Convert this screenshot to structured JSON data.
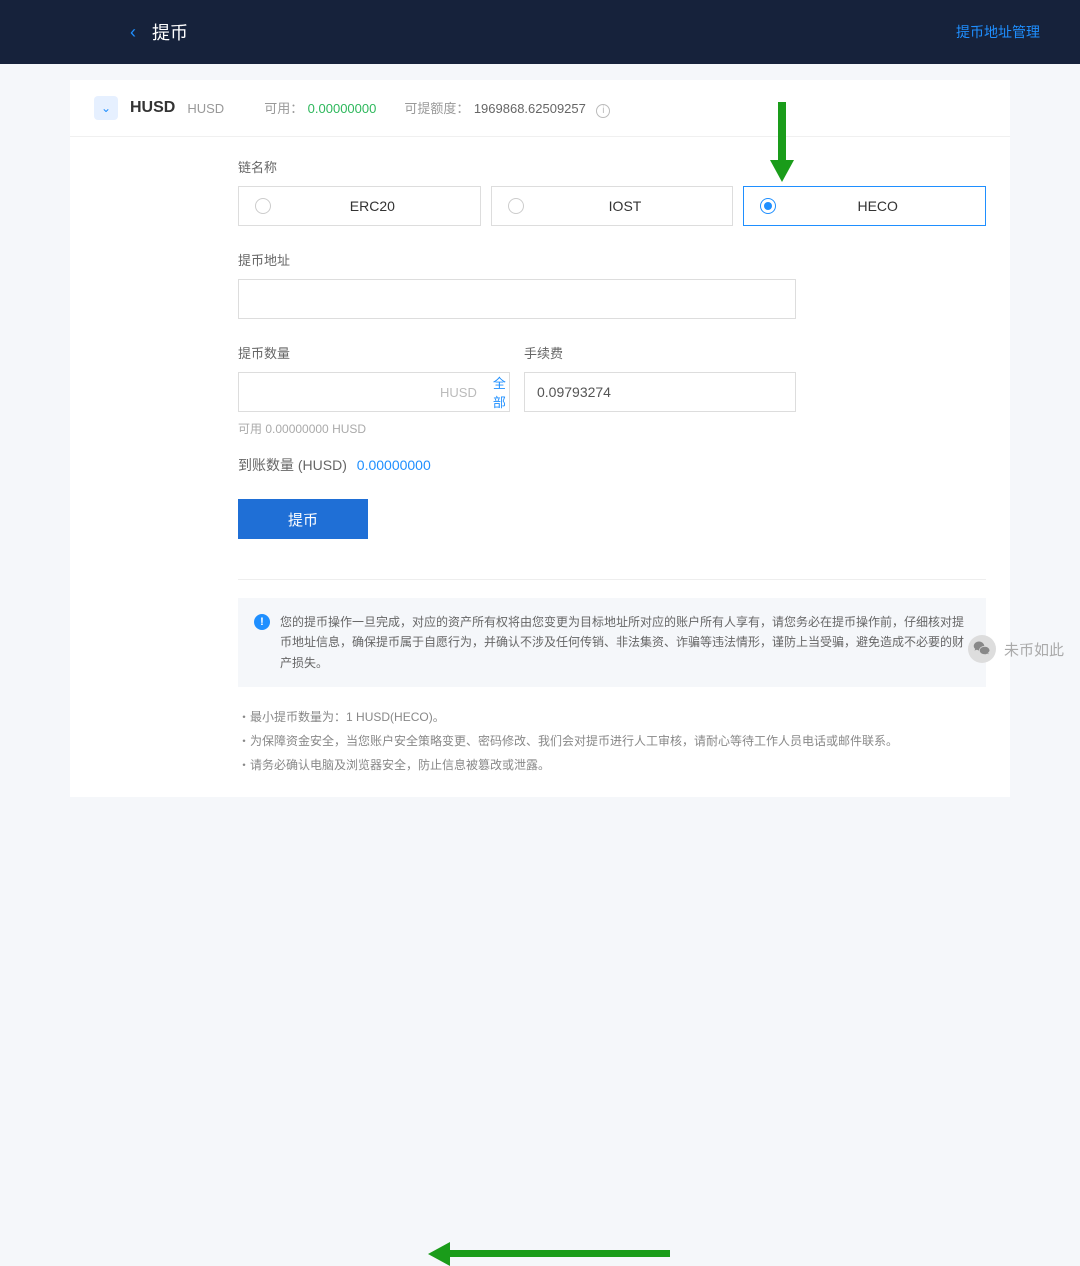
{
  "header": {
    "title": "提币",
    "manage_link": "提币地址管理"
  },
  "coin": {
    "symbol": "HUSD",
    "name": "HUSD",
    "available_label": "可用：",
    "available_value": "0.00000000",
    "limit_label": "可提额度：",
    "limit_value": "1969868.62509257"
  },
  "form": {
    "chain_label": "链名称",
    "chains": [
      "ERC20",
      "IOST",
      "HECO"
    ],
    "chain_selected": 2,
    "address_label": "提币地址",
    "address_value": "",
    "amount_label": "提币数量",
    "amount_unit": "HUSD",
    "amount_all": "全部",
    "fee_label": "手续费",
    "fee_value": "0.09793274",
    "available_hint": "可用 0.00000000 HUSD",
    "arrival_label": "到账数量 (HUSD)",
    "arrival_value": "0.00000000",
    "submit_label": "提币"
  },
  "notice": "您的提币操作一旦完成，对应的资产所有权将由您变更为目标地址所对应的账户所有人享有，请您务必在提币操作前，仔细核对提币地址信息，确保提币属于自愿行为，并确认不涉及任何传销、非法集资、诈骗等违法情形，谨防上当受骗，避免造成不必要的财产损失。",
  "rules": [
    "最小提币数量为：1 HUSD(HECO)。",
    "为保障资金安全，当您账户安全策略变更、密码修改、我们会对提币进行人工审核，请耐心等待工作人员电话或邮件联系。",
    "请务必确认电脑及浏览器安全，防止信息被篡改或泄露。"
  ],
  "watermark": "未币如此"
}
